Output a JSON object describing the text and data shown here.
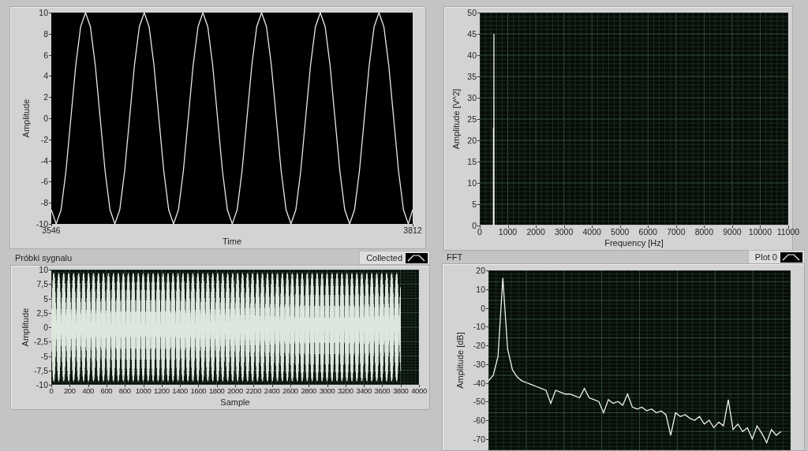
{
  "graphs": [
    {
      "kind": "chart",
      "chart_data": {
        "type": "line",
        "grid": false,
        "xlabel": "Time",
        "ylabel": "Amplitude",
        "xlim": [
          3546,
          3812
        ],
        "ylim": [
          -10,
          10
        ],
        "xticks": [
          3546,
          3812
        ],
        "yticks": [
          -10,
          -8,
          -6,
          -4,
          -2,
          0,
          2,
          4,
          6,
          8,
          10
        ],
        "x": [
          3546,
          3549.6,
          3553.2,
          3556.8,
          3560.4,
          3564,
          3567.6,
          3571.2,
          3574.8,
          3578.4,
          3582,
          3585.6,
          3589.2,
          3592.8,
          3596.4,
          3600,
          3603.6,
          3607.2,
          3610.8,
          3614.4,
          3618,
          3621.6,
          3625.2,
          3628.8,
          3632.4,
          3636,
          3639.6,
          3643.2,
          3646.8,
          3650.4,
          3654,
          3657.6,
          3661.2,
          3664.8,
          3668.4,
          3672,
          3675.6,
          3679.2,
          3682.8,
          3686.4,
          3690,
          3693.6,
          3697.2,
          3700.8,
          3704.4,
          3708,
          3711.6,
          3715.2,
          3718.8,
          3722.4,
          3726,
          3729.6,
          3733.2,
          3736.8,
          3740.4,
          3744,
          3747.6,
          3751.2,
          3754.8,
          3758.4,
          3762,
          3765.6,
          3769.2,
          3772.8,
          3776.4,
          3780,
          3783.6,
          3787.2,
          3790.8,
          3794.4,
          3798,
          3801.6,
          3805.2,
          3808.8,
          3812
        ],
        "series": [
          {
            "color": "#e8e8e8",
            "values": [
              -8.66,
              -10,
              -8.66,
              -5,
              0,
              5,
              8.66,
              10,
              8.66,
              5,
              0,
              -5,
              -8.66,
              -10,
              -8.66,
              -5,
              0,
              5,
              8.66,
              10,
              8.66,
              5,
              0,
              -5,
              -8.66,
              -10,
              -8.66,
              -5,
              0,
              5,
              8.66,
              10,
              8.66,
              5,
              0,
              -5,
              -8.66,
              -10,
              -8.66,
              -5,
              0,
              5,
              8.66,
              10,
              8.66,
              5,
              0,
              -5,
              -8.66,
              -10,
              -8.66,
              -5,
              0,
              5,
              8.66,
              10,
              8.66,
              5,
              0,
              -5,
              -8.66,
              -10,
              -8.66,
              -5,
              0,
              5,
              8.66,
              10,
              8.66,
              5,
              0,
              -5,
              -8.66,
              -10,
              -8.66
            ]
          }
        ]
      }
    },
    {
      "kind": "chart",
      "chart_data": {
        "type": "line",
        "grid": true,
        "xlabel": "Frequency [Hz]",
        "ylabel": "Amplitude [V^2]",
        "xlim": [
          0,
          11000
        ],
        "ylim": [
          0,
          50
        ],
        "xticks": [
          0,
          1000,
          2000,
          3000,
          4000,
          5000,
          6000,
          7000,
          8000,
          9000,
          10000,
          11000
        ],
        "yticks": [
          0,
          5,
          10,
          15,
          20,
          25,
          30,
          35,
          40,
          45,
          50
        ],
        "x": [
          0,
          485,
          490,
          495,
          500,
          505,
          510,
          11000
        ],
        "series": [
          {
            "color": "#f0f0f0",
            "values": [
              0,
              0,
              23,
              0,
              0,
              45,
              0,
              0
            ]
          }
        ]
      }
    },
    {
      "kind": "waveform",
      "grid": true,
      "label": "Próbki sygnalu",
      "legend": "Collected",
      "xlabel": "Sample",
      "ylabel": "Amplitude",
      "xticks": [
        "0",
        "200",
        "400",
        "600",
        "800",
        "1000",
        "1200",
        "1400",
        "1600",
        "1800",
        "2000",
        "2200",
        "2400",
        "2600",
        "2800",
        "3000",
        "3200",
        "3400",
        "3600",
        "3800",
        "4000"
      ],
      "yticks": [
        "10",
        "7,5",
        "5",
        "2,5",
        "0",
        "-2,5",
        "-5",
        "-7,5",
        "-10"
      ]
    },
    {
      "kind": "chart",
      "label": "FFT",
      "chart_data": {
        "type": "line",
        "grid": true,
        "ylabel": "Amplitude [dB]",
        "ylim": [
          -76,
          20
        ],
        "yticks": [
          -70,
          -60,
          -50,
          -40,
          -30,
          -20,
          -10,
          0,
          10,
          20
        ],
        "series": [
          {
            "name": "Plot 0",
            "color": "#f0f0f0",
            "values": [
              -39,
              -36,
              -26,
              16,
              -22,
              -33,
              -37,
              -39,
              -40,
              -41,
              -42,
              -43,
              -44,
              -51,
              -44,
              -45,
              -46,
              -46,
              -47,
              -48,
              -43,
              -48,
              -49,
              -50,
              -56,
              -49,
              -51,
              -50,
              -52,
              -46,
              -53,
              -54,
              -53,
              -55,
              -54,
              -56,
              -55,
              -57,
              -68,
              -56,
              -58,
              -57,
              -59,
              -60,
              -58,
              -62,
              -60,
              -64,
              -61,
              -63,
              -49,
              -65,
              -62,
              -66,
              -64,
              -70,
              -63,
              -67,
              -72,
              -65,
              -68,
              -66
            ]
          }
        ]
      }
    }
  ]
}
